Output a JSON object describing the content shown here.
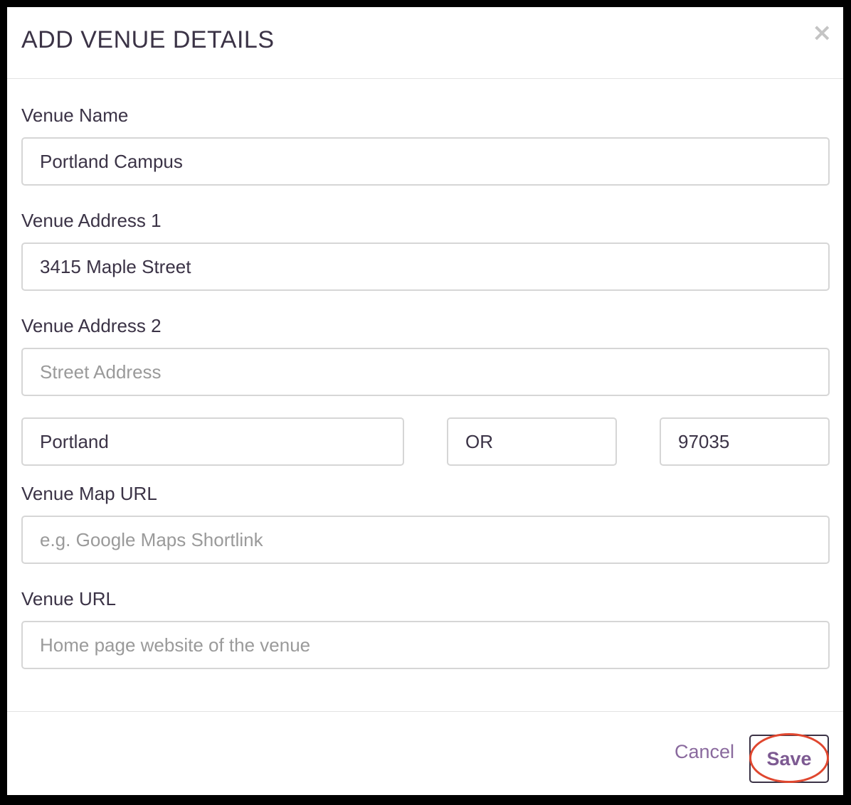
{
  "modal": {
    "title": "ADD VENUE DETAILS",
    "close_label": "×"
  },
  "form": {
    "venue_name": {
      "label": "Venue Name",
      "value": "Portland Campus",
      "placeholder": ""
    },
    "address1": {
      "label": "Venue Address 1",
      "value": "3415 Maple Street",
      "placeholder": ""
    },
    "address2": {
      "label": "Venue Address 2",
      "value": "",
      "placeholder": "Street Address"
    },
    "city": {
      "value": "Portland"
    },
    "state": {
      "value": "OR"
    },
    "zip": {
      "value": "97035"
    },
    "map_url": {
      "label": "Venue Map URL",
      "value": "",
      "placeholder": "e.g. Google Maps Shortlink"
    },
    "venue_url": {
      "label": "Venue URL",
      "value": "",
      "placeholder": "Home page website of the venue"
    }
  },
  "footer": {
    "cancel_label": "Cancel",
    "save_label": "Save"
  },
  "colors": {
    "text": "#3b3346",
    "accent": "#7d5a92",
    "highlight": "#e0472f"
  }
}
